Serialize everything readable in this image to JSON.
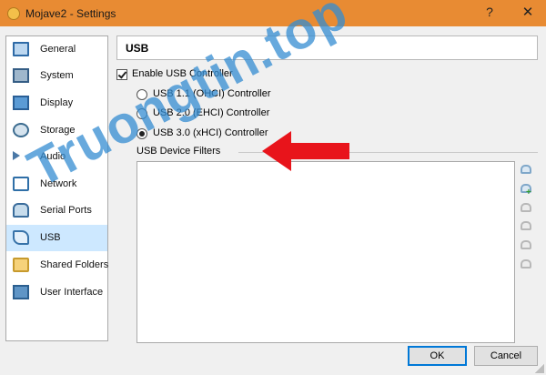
{
  "window": {
    "title": "Mojave2 - Settings",
    "help_glyph": "?",
    "close_glyph": "✕"
  },
  "sidebar": {
    "items": [
      {
        "label": "General",
        "icon": "monitor-icon"
      },
      {
        "label": "System",
        "icon": "chip-icon"
      },
      {
        "label": "Display",
        "icon": "display-icon"
      },
      {
        "label": "Storage",
        "icon": "disk-icon"
      },
      {
        "label": "Audio",
        "icon": "speaker-icon"
      },
      {
        "label": "Network",
        "icon": "network-icon"
      },
      {
        "label": "Serial Ports",
        "icon": "serial-port-icon"
      },
      {
        "label": "USB",
        "icon": "usb-icon",
        "selected": true
      },
      {
        "label": "Shared Folders",
        "icon": "folder-icon"
      },
      {
        "label": "User Interface",
        "icon": "user-interface-icon"
      }
    ]
  },
  "page": {
    "title": "USB",
    "enable_usb_label": "Enable USB Controller",
    "enable_usb_checked": true,
    "controllers": [
      {
        "label": "USB 1.1 (OHCI) Controller",
        "selected": false
      },
      {
        "label": "USB 2.0 (EHCI) Controller",
        "selected": false
      },
      {
        "label": "USB 3.0 (xHCI) Controller",
        "selected": true
      }
    ],
    "filters_label": "USB Device Filters",
    "filter_tools": [
      {
        "icon": "add-empty-filter-icon",
        "enabled": true
      },
      {
        "icon": "add-filter-from-device-icon",
        "enabled": true
      },
      {
        "icon": "edit-filter-icon",
        "enabled": false
      },
      {
        "icon": "remove-filter-icon",
        "enabled": false
      },
      {
        "icon": "move-filter-up-icon",
        "enabled": false
      },
      {
        "icon": "move-filter-down-icon",
        "enabled": false
      }
    ]
  },
  "buttons": {
    "ok": "OK",
    "cancel": "Cancel"
  },
  "annotation": {
    "arrow_color": "#e8141b"
  },
  "watermark": {
    "text": "Truongtin.top"
  },
  "colors": {
    "titlebar": "#e88b33",
    "selection": "#cde8ff"
  }
}
